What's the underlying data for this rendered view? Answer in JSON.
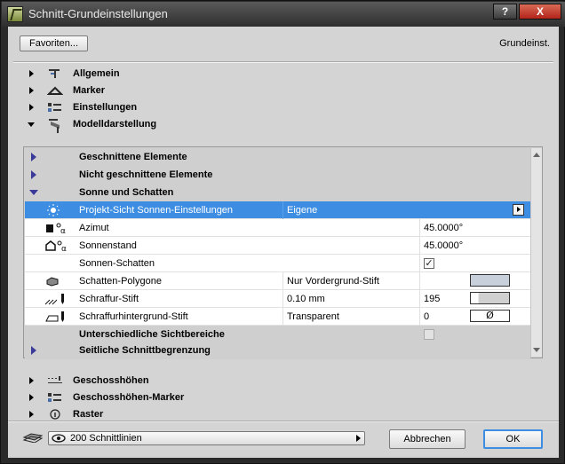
{
  "window": {
    "title": "Schnitt-Grundeinstellungen",
    "help_label": "?",
    "close_label": "X"
  },
  "toolbar": {
    "favorites_label": "Favoriten...",
    "preset_label": "Grundeinst."
  },
  "sections_top": [
    {
      "label": "Allgemein",
      "icon": "general-settings-icon"
    },
    {
      "label": "Marker",
      "icon": "marker-icon"
    },
    {
      "label": "Einstellungen",
      "icon": "settings-icon"
    },
    {
      "label": "Modelldarstellung",
      "icon": "model-display-icon",
      "expanded": true
    }
  ],
  "model_display": {
    "subsections": {
      "cut": "Geschnittene Elemente",
      "uncut": "Nicht geschnittene Elemente",
      "sun": "Sonne und Schatten",
      "visible_areas": "Unterschiedliche Sichtbereiche",
      "side_boundary": "Seitliche Schnittbegrenzung"
    },
    "rows": {
      "sun_settings": {
        "label": "Projekt-Sicht Sonnen-Einstellungen",
        "value": "Eigene",
        "icon": "sun-icon"
      },
      "azimuth": {
        "label": "Azimut",
        "value": "45.0000°",
        "icon": "azimuth-icon"
      },
      "altitude": {
        "label": "Sonnenstand",
        "value": "45.0000°",
        "icon": "sun-altitude-icon"
      },
      "shadows": {
        "label": "Sonnen-Schatten",
        "checked": true,
        "check_glyph": "✓"
      },
      "shadow_polygons": {
        "label": "Schatten-Polygone",
        "value": "Nur Vordergrund-Stift",
        "icon": "shadow-polygon-icon",
        "swatch_color": "#c8d0dc"
      },
      "hatch_pen": {
        "label": "Schraffur-Stift",
        "value": "0.10 mm",
        "pen": "195",
        "icon": "hatch-pen-icon",
        "swatch_color": "#d0d0d0"
      },
      "hatch_bg_pen": {
        "label": "Schraffurhintergrund-Stift",
        "value": "Transparent",
        "pen": "0",
        "icon": "hatch-background-icon",
        "swatch_glyph": "Ø"
      }
    }
  },
  "sections_bottom": [
    {
      "label": "Geschosshöhen",
      "icon": "story-levels-icon"
    },
    {
      "label": "Geschosshöhen-Marker",
      "icon": "story-marker-icon"
    },
    {
      "label": "Raster",
      "icon": "grid-icon"
    }
  ],
  "footer": {
    "layer_value": "200 Schnittlinien",
    "cancel_label": "Abbrechen",
    "ok_label": "OK"
  },
  "colors": {
    "selection": "#3d8ee3",
    "dialog_bg": "#d4d4d4",
    "title_bar": "#2e2e2e"
  }
}
